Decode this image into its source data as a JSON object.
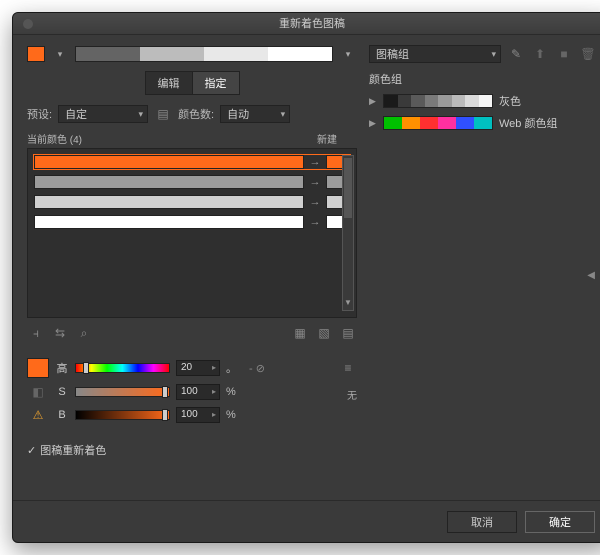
{
  "window": {
    "title": "重新着色图稿"
  },
  "topbar": {
    "dropdown": "图稿组"
  },
  "tabs": {
    "edit": "编辑",
    "assign": "指定"
  },
  "preset": {
    "label": "预设:",
    "value": "自定",
    "count_label": "颜色数:",
    "count_value": "自动"
  },
  "colortable": {
    "current_label": "当前颜色 (4)",
    "new_label": "新建",
    "rows": [
      {
        "bar": "#ff6a1a",
        "swatch": "#ff6a1a"
      },
      {
        "bar": "#9c9c9c",
        "swatch": "#9c9c9c"
      },
      {
        "bar": "#d0d0d0",
        "swatch": "#d0d0d0"
      },
      {
        "bar": "#ffffff",
        "swatch": "#ffffff"
      }
    ]
  },
  "sliders": {
    "h": {
      "label": "高",
      "value": "20",
      "unit": "。",
      "sub": "- ⊘"
    },
    "s": {
      "label": "S",
      "value": "100",
      "unit": "%"
    },
    "b": {
      "label": "B",
      "value": "100",
      "unit": "%"
    },
    "none": "无"
  },
  "checkbox": {
    "label": "图稿重新着色"
  },
  "groups": {
    "header": "颜色组",
    "items": [
      {
        "label": "灰色",
        "kind": "grey"
      },
      {
        "label": "Web 颜色组",
        "kind": "web"
      }
    ]
  },
  "footer": {
    "cancel": "取消",
    "ok": "确定"
  }
}
